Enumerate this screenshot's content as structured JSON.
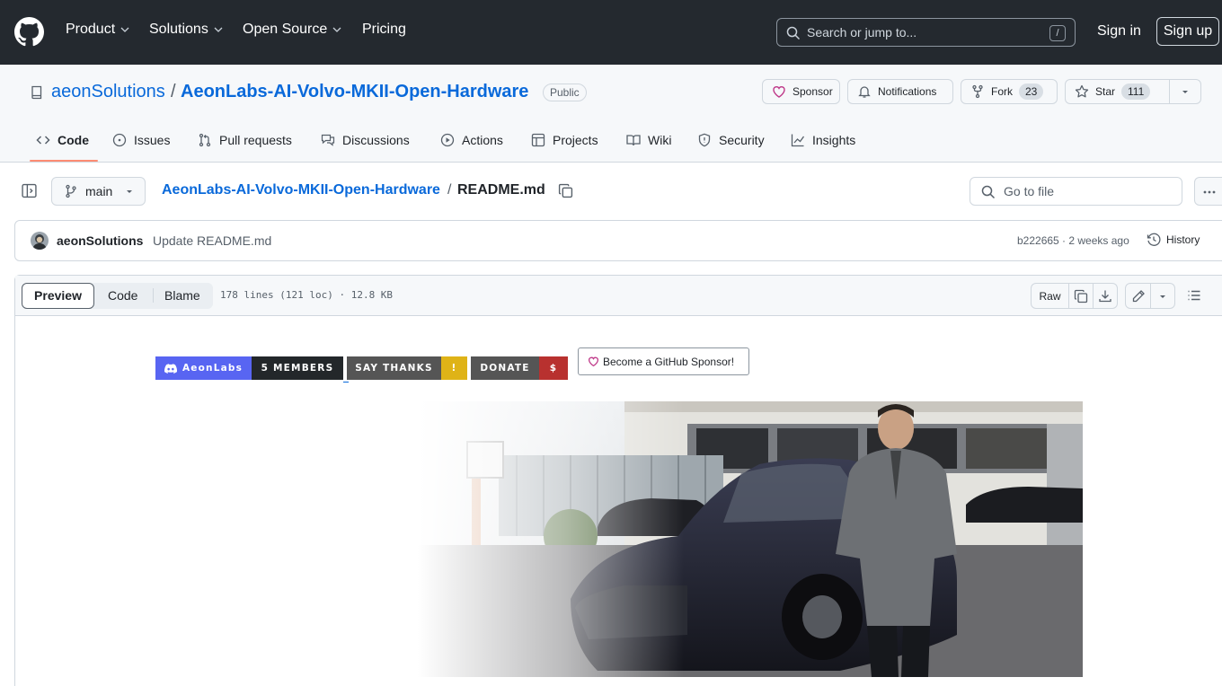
{
  "header": {
    "nav": [
      "Product",
      "Solutions",
      "Open Source",
      "Pricing"
    ],
    "search_placeholder": "Search or jump to...",
    "search_shortcut": "/",
    "sign_in": "Sign in",
    "sign_up": "Sign up"
  },
  "repo": {
    "owner": "aeonSolutions",
    "separator": "/",
    "name": "AeonLabs-AI-Volvo-MKII-Open-Hardware",
    "visibility": "Public",
    "sponsor_label": "Sponsor",
    "notifications_label": "Notifications",
    "fork_label": "Fork",
    "fork_count": "23",
    "star_label": "Star",
    "star_count": "111"
  },
  "tabs": [
    "Code",
    "Issues",
    "Pull requests",
    "Discussions",
    "Actions",
    "Projects",
    "Wiki",
    "Security",
    "Insights"
  ],
  "file_nav": {
    "branch": "main",
    "breadcrumb_repo": "AeonLabs-AI-Volvo-MKII-Open-Hardware",
    "breadcrumb_sep": "/",
    "breadcrumb_file": "README.md",
    "go_to_file": "Go to file"
  },
  "commit": {
    "author": "aeonSolutions",
    "message": "Update README.md",
    "meta": "b222665 · 2 weeks ago",
    "history": "History"
  },
  "file": {
    "view_preview": "Preview",
    "view_code": "Code",
    "view_blame": "Blame",
    "info": "178 lines (121 loc) · 12.8 KB",
    "raw": "Raw"
  },
  "badges": {
    "discord_left": "AeonLabs",
    "discord_right": "5 MEMBERS",
    "thanks_left": "SAY THANKS",
    "thanks_right": "!",
    "donate_left": "DONATE",
    "donate_right": "$",
    "sponsor_button": "Become a GitHub Sponsor!"
  },
  "colors": {
    "header_bg": "#24292f",
    "link": "#0969da",
    "tab_underline": "#fd8c73",
    "discord_left": "#5865f2",
    "discord_right": "#23272a",
    "thanks_left": "#555555",
    "thanks_right": "#dfb317",
    "donate_left": "#555555",
    "donate_right": "#b8312f"
  }
}
